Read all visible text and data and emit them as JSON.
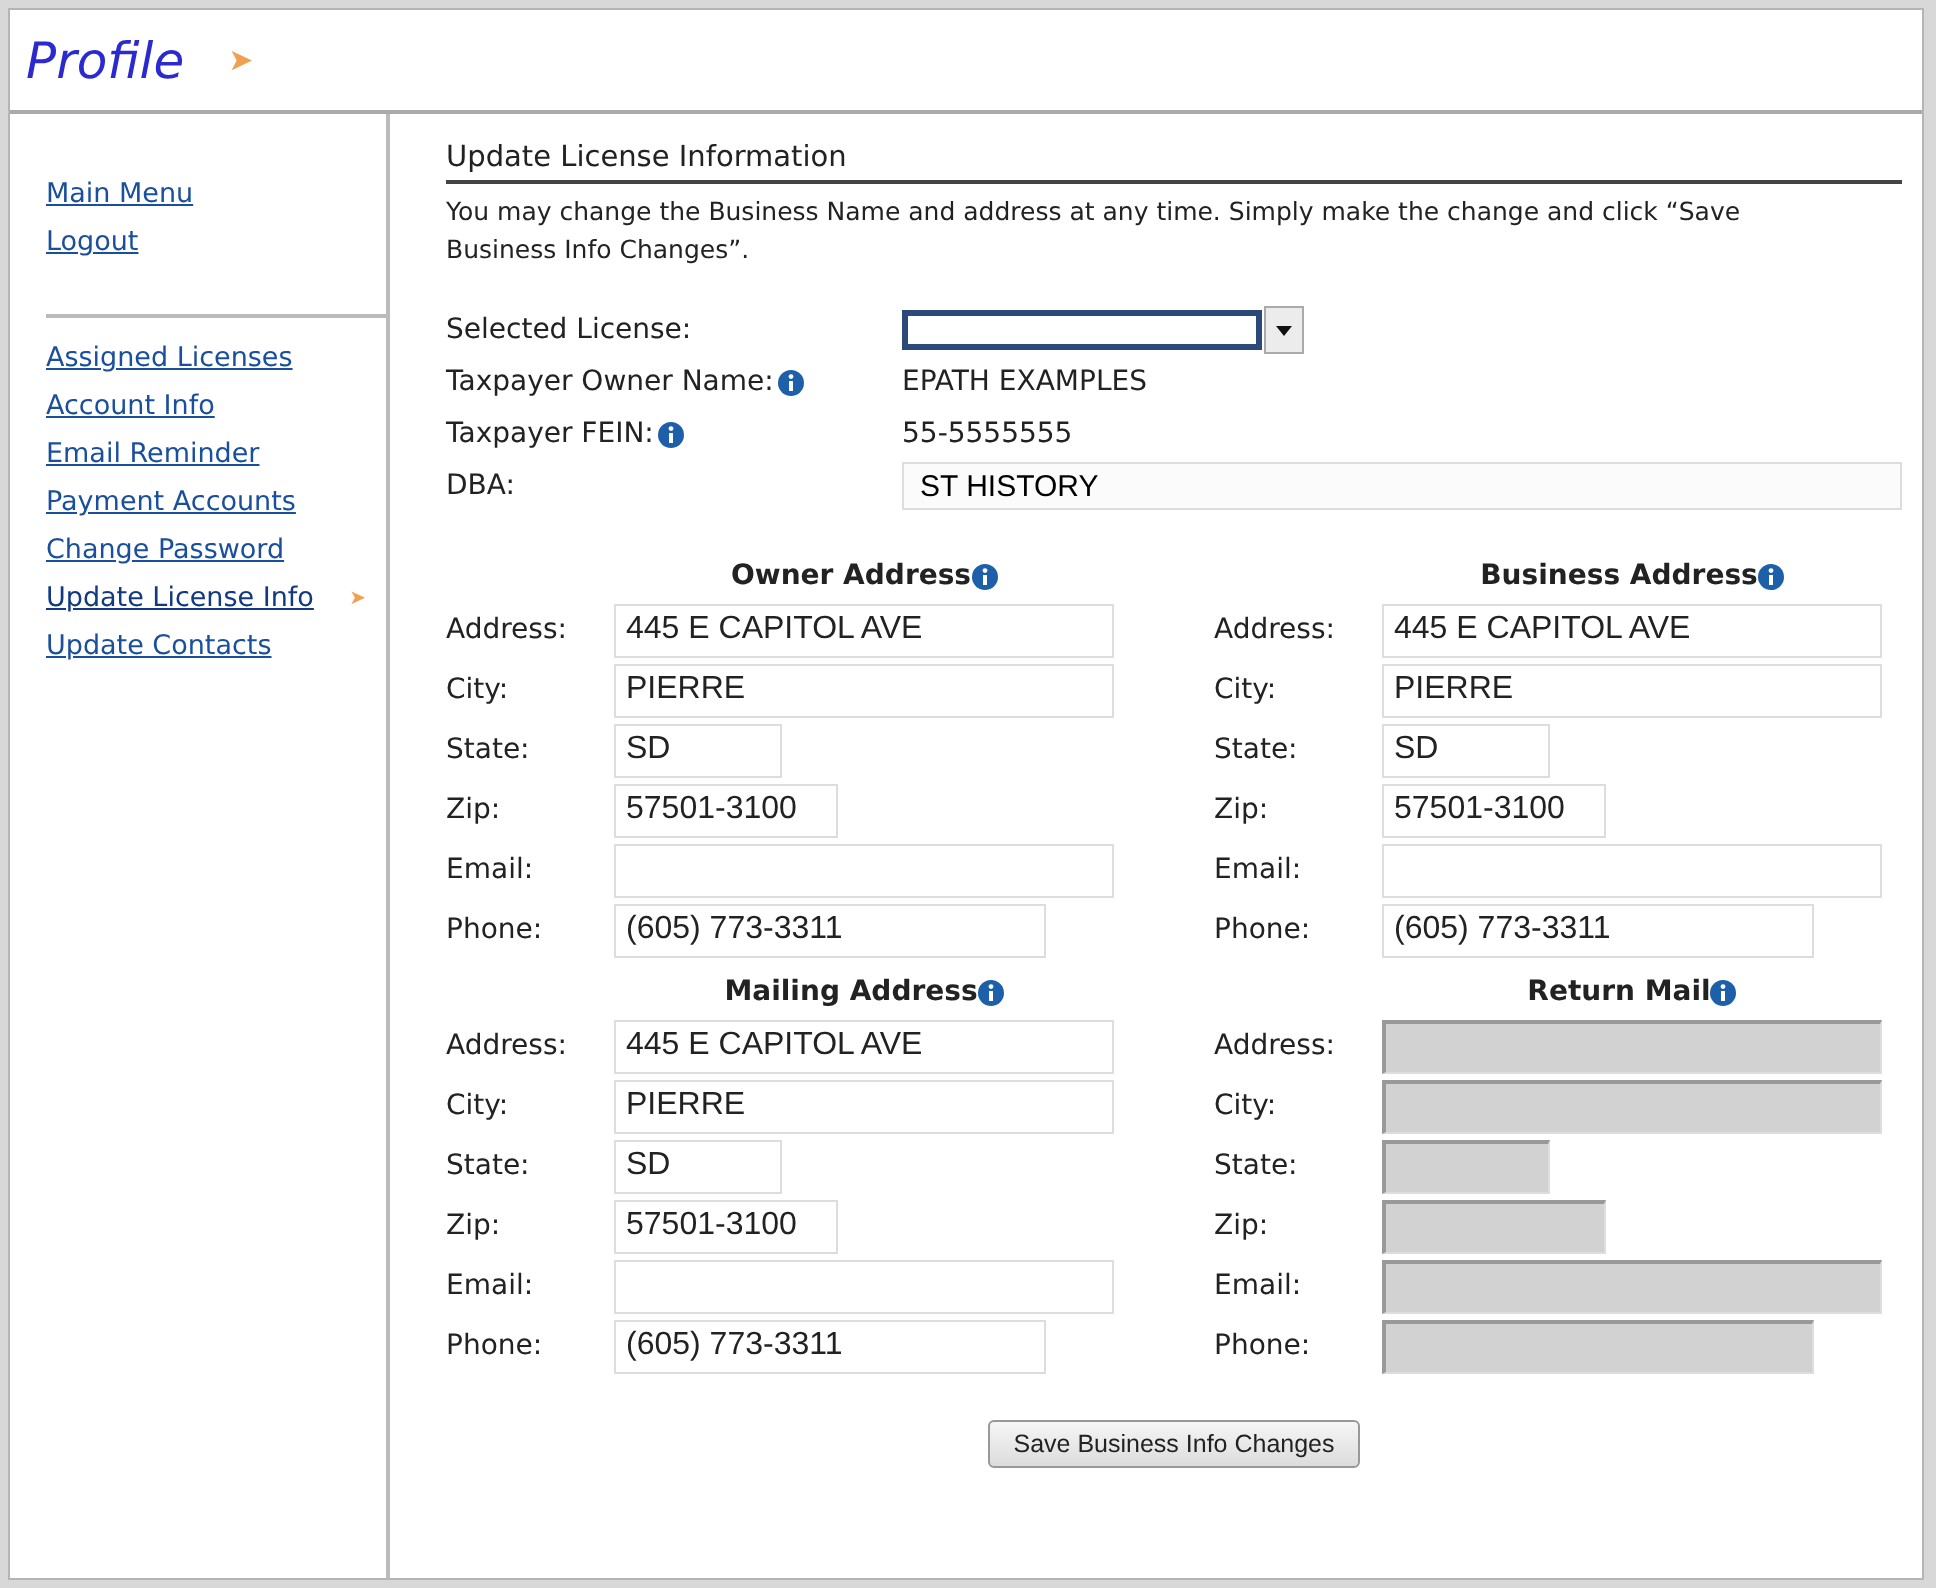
{
  "header": {
    "title": "Profile",
    "arrow": "➤"
  },
  "sidebar": {
    "groups": [
      {
        "items": [
          {
            "label": "Main Menu",
            "selected": false
          },
          {
            "label": "Logout",
            "selected": false
          }
        ]
      },
      {
        "items": [
          {
            "label": "Assigned Licenses",
            "selected": false
          },
          {
            "label": "Account Info",
            "selected": false
          },
          {
            "label": "Email Reminder",
            "selected": false
          },
          {
            "label": "Payment Accounts",
            "selected": false
          },
          {
            "label": "Change Password",
            "selected": false
          },
          {
            "label": "Update License Info",
            "selected": true
          },
          {
            "label": "Update Contacts",
            "selected": false
          }
        ]
      }
    ],
    "marker": "➤"
  },
  "main": {
    "heading": "Update License Information",
    "intro": "You may change the Business Name and address at any time. Simply make the change and click “Save Business Info Changes”.",
    "license": {
      "label": "Selected License:"
    },
    "info": [
      {
        "label": "Taxpayer Owner Name:",
        "value": "EPATH EXAMPLES"
      },
      {
        "label": "Taxpayer FEIN:",
        "value": "55-5555555"
      }
    ],
    "dba": {
      "label": "DBA:",
      "value": "ST HISTORY"
    },
    "sections": [
      {
        "title": "Owner Address",
        "disabled": false,
        "fields": [
          {
            "label": "Address:",
            "kind": "long",
            "value": "445 E CAPITOL AVE"
          },
          {
            "label": "City:",
            "kind": "long",
            "value": "PIERRE"
          },
          {
            "label": "State:",
            "kind": "state",
            "value": "SD"
          },
          {
            "label": "Zip:",
            "kind": "zip",
            "value": "57501-3100"
          },
          {
            "label": "Email:",
            "kind": "long"
          },
          {
            "label": "Phone:",
            "kind": "phone",
            "value": "(605) 773-3311"
          }
        ]
      },
      {
        "title": "Business Address",
        "disabled": false,
        "fields": [
          {
            "label": "Address:",
            "kind": "long",
            "value": "445 E CAPITOL AVE"
          },
          {
            "label": "City:",
            "kind": "long",
            "value": "PIERRE"
          },
          {
            "label": "State:",
            "kind": "state",
            "value": "SD"
          },
          {
            "label": "Zip:",
            "kind": "zip",
            "value": "57501-3100"
          },
          {
            "label": "Email:",
            "kind": "long"
          },
          {
            "label": "Phone:",
            "kind": "phone",
            "value": "(605) 773-3311"
          }
        ]
      },
      {
        "title": "Mailing Address",
        "disabled": false,
        "fields": [
          {
            "label": "Address:",
            "kind": "long",
            "value": "445 E CAPITOL AVE"
          },
          {
            "label": "City:",
            "kind": "long",
            "value": "PIERRE"
          },
          {
            "label": "State:",
            "kind": "state",
            "value": "SD"
          },
          {
            "label": "Zip:",
            "kind": "zip",
            "value": "57501-3100"
          },
          {
            "label": "Email:",
            "kind": "long"
          },
          {
            "label": "Phone:",
            "kind": "phone",
            "value": "(605) 773-3311"
          }
        ]
      },
      {
        "title": "Return Mail",
        "disabled": true,
        "fields": [
          {
            "label": "Address:",
            "kind": "long"
          },
          {
            "label": "City:",
            "kind": "long"
          },
          {
            "label": "State:",
            "kind": "state"
          },
          {
            "label": "Zip:",
            "kind": "zip"
          },
          {
            "label": "Email:",
            "kind": "long"
          },
          {
            "label": "Phone:",
            "kind": "phone"
          }
        ]
      }
    ],
    "save_button": "Save Business Info Changes"
  }
}
